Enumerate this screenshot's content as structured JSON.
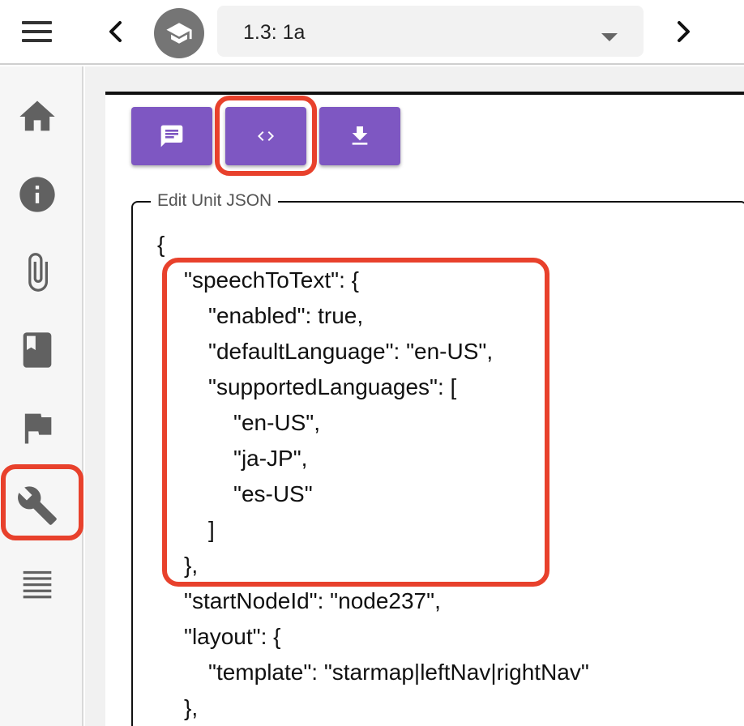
{
  "topbar": {
    "menu_icon": "menu-icon",
    "prev_icon": "chevron-left-icon",
    "next_icon": "chevron-right-icon",
    "avatar_icon": "school-icon",
    "unit_select": {
      "value": "1.3: 1a"
    }
  },
  "sidebar": {
    "items": [
      {
        "icon": "home-icon"
      },
      {
        "icon": "info-icon"
      },
      {
        "icon": "paperclip-icon"
      },
      {
        "icon": "book-icon"
      },
      {
        "icon": "flag-icon"
      },
      {
        "icon": "wrench-icon"
      },
      {
        "icon": "list-icon"
      }
    ]
  },
  "toolbar": {
    "buttons": [
      {
        "icon": "comment-icon"
      },
      {
        "icon": "code-icon"
      },
      {
        "icon": "download-icon"
      }
    ]
  },
  "editor": {
    "legend": "Edit Unit JSON",
    "lines": [
      "{",
      "\"speechToText\": {",
      "\"enabled\": true,",
      "\"defaultLanguage\": \"en-US\",",
      "\"supportedLanguages\": [",
      "\"en-US\",",
      "\"ja-JP\",",
      "\"es-US\"",
      "]",
      "},",
      "\"startNodeId\": \"node237\",",
      "\"layout\": {",
      "\"template\": \"starmap|leftNav|rightNav\"",
      "},"
    ]
  },
  "colors": {
    "accent": "#7e57c2",
    "highlight": "#e8412c"
  }
}
